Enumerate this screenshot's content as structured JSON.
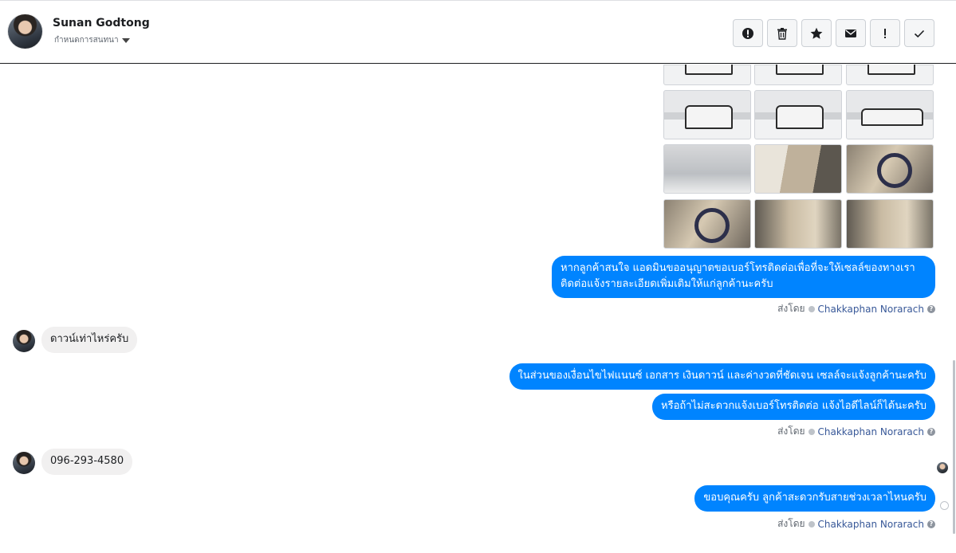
{
  "header": {
    "contact_name": "Sunan Godtong",
    "assign_label": "กำหนดการสนทนา"
  },
  "toolbar": {
    "buttons": [
      {
        "name": "mark-spam-button",
        "icon": "alert-circle-icon"
      },
      {
        "name": "delete-button",
        "icon": "trash-icon"
      },
      {
        "name": "star-button",
        "icon": "star-icon"
      },
      {
        "name": "mark-unread-button",
        "icon": "envelope-icon"
      },
      {
        "name": "follow-up-button",
        "icon": "exclamation-icon"
      },
      {
        "name": "mark-done-button",
        "icon": "check-icon"
      }
    ]
  },
  "messages": {
    "m1": "หากลูกค้าสนใจ แอดมินขออนุญาตขอเบอร์โทรติดต่อเพื่อที่จะให้เซลล์ของทางเราติดต่อแจ้งรายละเอียดเพิ่มเติมให้แก่ลูกค้านะครับ",
    "m2": "ดาวน์เท่าไหร่ครับ",
    "m3": "ในส่วนของเงื่อนไขไฟแนนซ์ เอกสาร เงินดาวน์ และค่างวดที่ชัดเจน เซลล์จะแจ้งลูกค้านะครับ",
    "m4": "หรือถ้าไม่สะดวกแจ้งเบอร์โทรติดต่อ แจ้งไอดีไลน์ก็ได้นะครับ",
    "m5": "096-293-4580",
    "m6": "ขอบคุณครับ ลูกค้าสะดวกรับสายช่วงเวลาไหนครับ"
  },
  "sent_by": {
    "prefix": "ส่งโดย",
    "agent": "Chakkaphan Norarach",
    "help": "?"
  },
  "colors": {
    "outgoing_bubble": "#0084ff",
    "incoming_bubble": "#f1f0f0",
    "agent_link": "#385898"
  }
}
